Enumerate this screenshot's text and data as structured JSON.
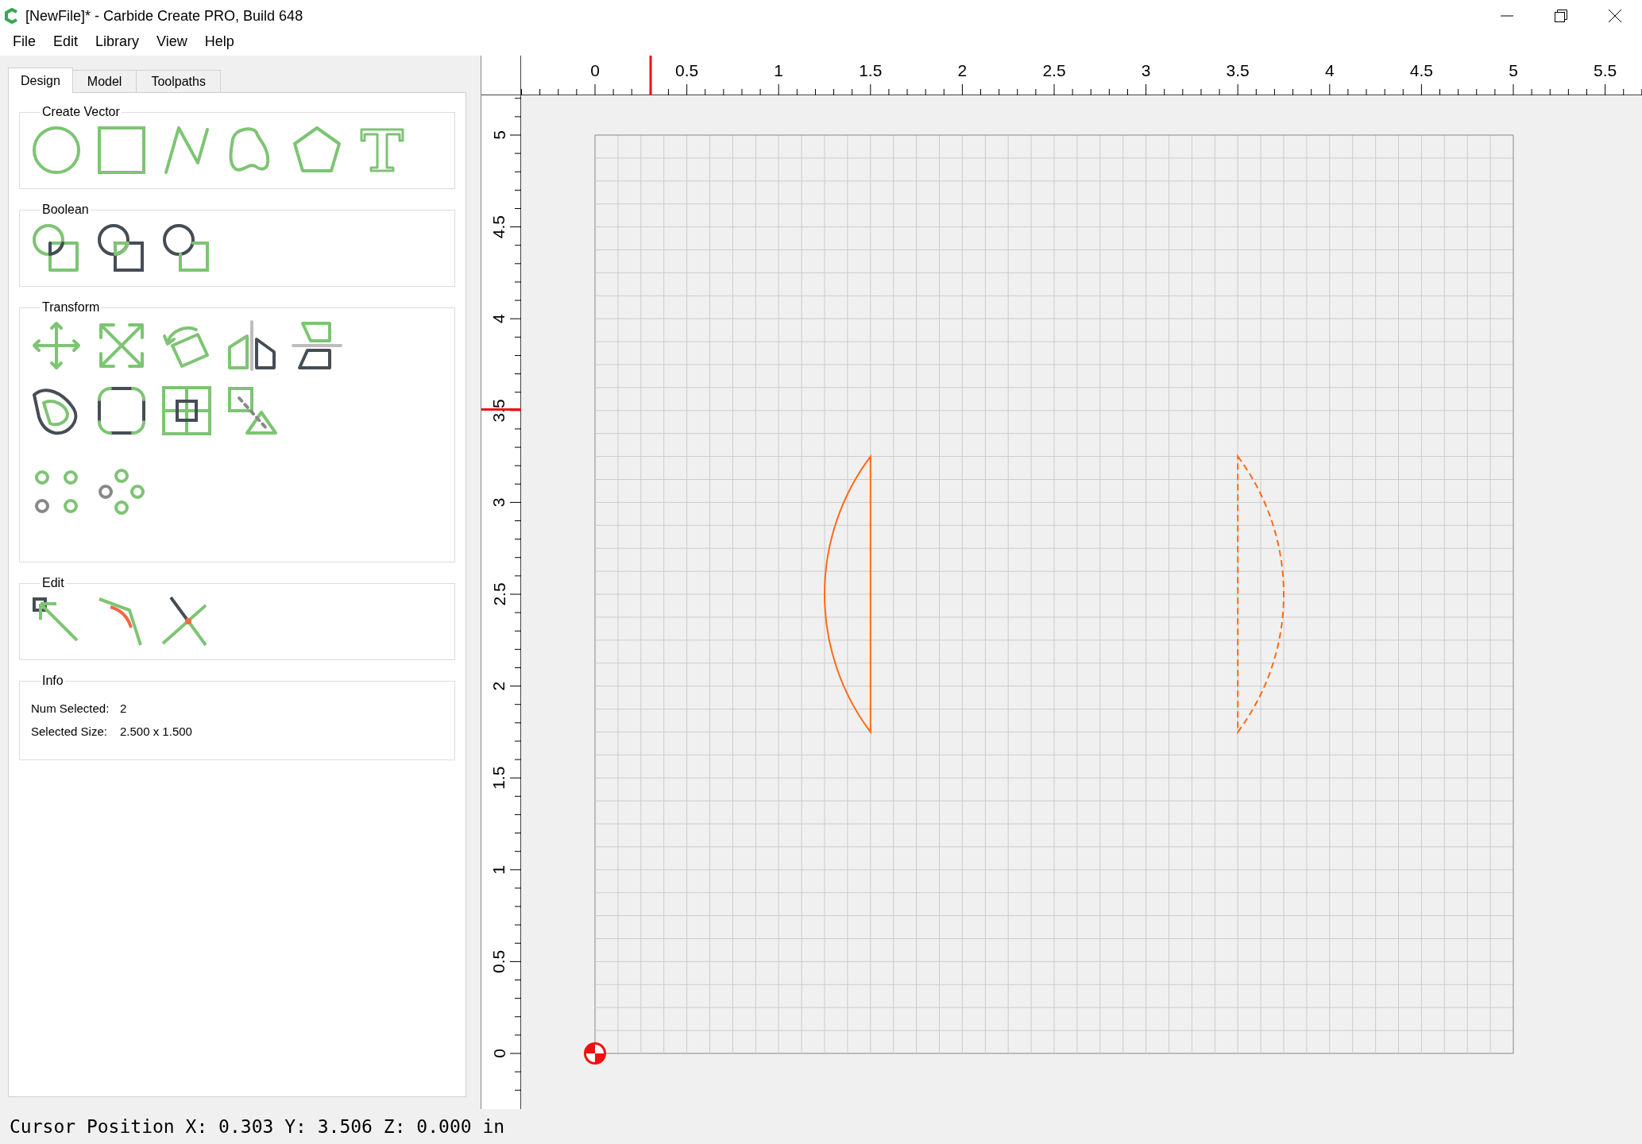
{
  "window": {
    "title": "[NewFile]* - Carbide Create PRO, Build 648"
  },
  "menu": [
    "File",
    "Edit",
    "Library",
    "View",
    "Help"
  ],
  "tabs": [
    {
      "label": "Design",
      "selected": true
    },
    {
      "label": "Model",
      "selected": false
    },
    {
      "label": "Toolpaths",
      "selected": false
    }
  ],
  "groups": [
    {
      "kind": "tools",
      "title": "Create Vector"
    },
    {
      "kind": "tools",
      "title": "Boolean"
    },
    {
      "kind": "tools",
      "title": "Transform"
    },
    {
      "kind": "tools",
      "title": "Edit"
    },
    {
      "kind": "info",
      "title": "Info",
      "rows": [
        {
          "label": "Num Selected:",
          "value": "2"
        },
        {
          "label": "Selected Size:",
          "value": "2.500 x 1.500"
        }
      ]
    }
  ],
  "rulers": {
    "top": {
      "labels": [
        "0",
        "0.5",
        "1",
        "1.5",
        "2",
        "2.5",
        "3",
        "3.5",
        "4",
        "4.5",
        "5",
        "5.5"
      ],
      "marker": {
        "level": 0.0606
      }
    },
    "left": {
      "labels": [
        "0",
        "0.5",
        "1",
        "1.5",
        "2",
        "2.5",
        "3",
        "3.5",
        "4",
        "4.5",
        "5"
      ],
      "marker": {
        "level": 0.7012
      }
    }
  },
  "status_bar": "Cursor Position X: 0.303 Y: 3.506 Z: 0.000 in"
}
